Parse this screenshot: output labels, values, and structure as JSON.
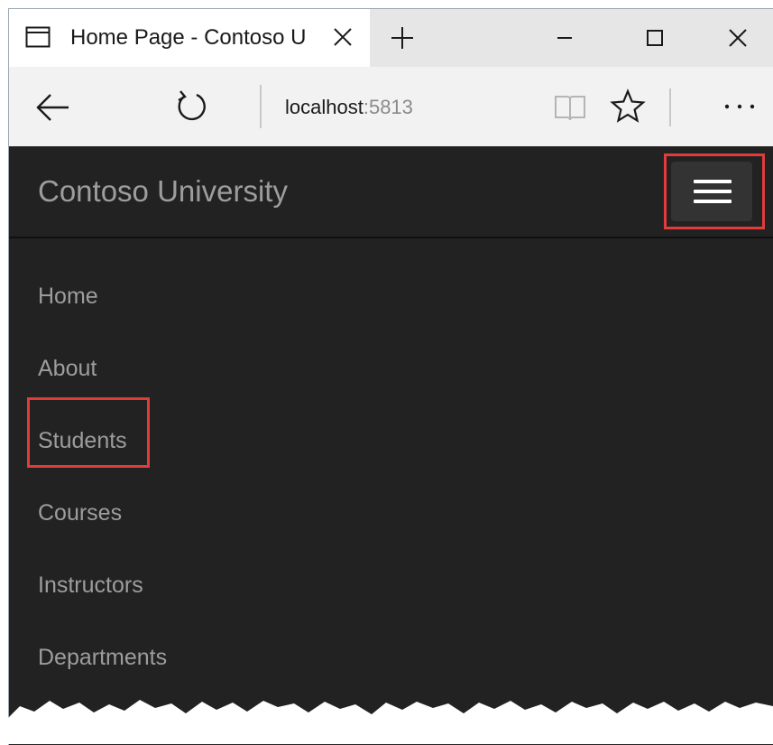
{
  "browser": {
    "tab": {
      "title": "Home Page - Contoso U"
    },
    "address": {
      "host": "localhost",
      "port": ":5813"
    }
  },
  "site": {
    "brand": "Contoso University",
    "menu": [
      {
        "label": "Home"
      },
      {
        "label": "About"
      },
      {
        "label": "Students"
      },
      {
        "label": "Courses"
      },
      {
        "label": "Instructors"
      },
      {
        "label": "Departments"
      }
    ]
  },
  "icons": {
    "tab_page": "page-icon",
    "tab_close": "close-icon",
    "new_tab": "plus-icon",
    "minimize": "minimize-icon",
    "maximize": "maximize-icon",
    "close_window": "close-icon",
    "back": "arrow-left-icon",
    "refresh": "refresh-icon",
    "reading_view": "book-icon",
    "favorite": "star-icon",
    "more": "ellipsis-icon",
    "menu_toggle": "hamburger-icon"
  },
  "colors": {
    "navbar": "#222222",
    "nav_text": "#9d9d9d",
    "toggle_bg": "#333333",
    "highlight": "#e03c3c"
  }
}
